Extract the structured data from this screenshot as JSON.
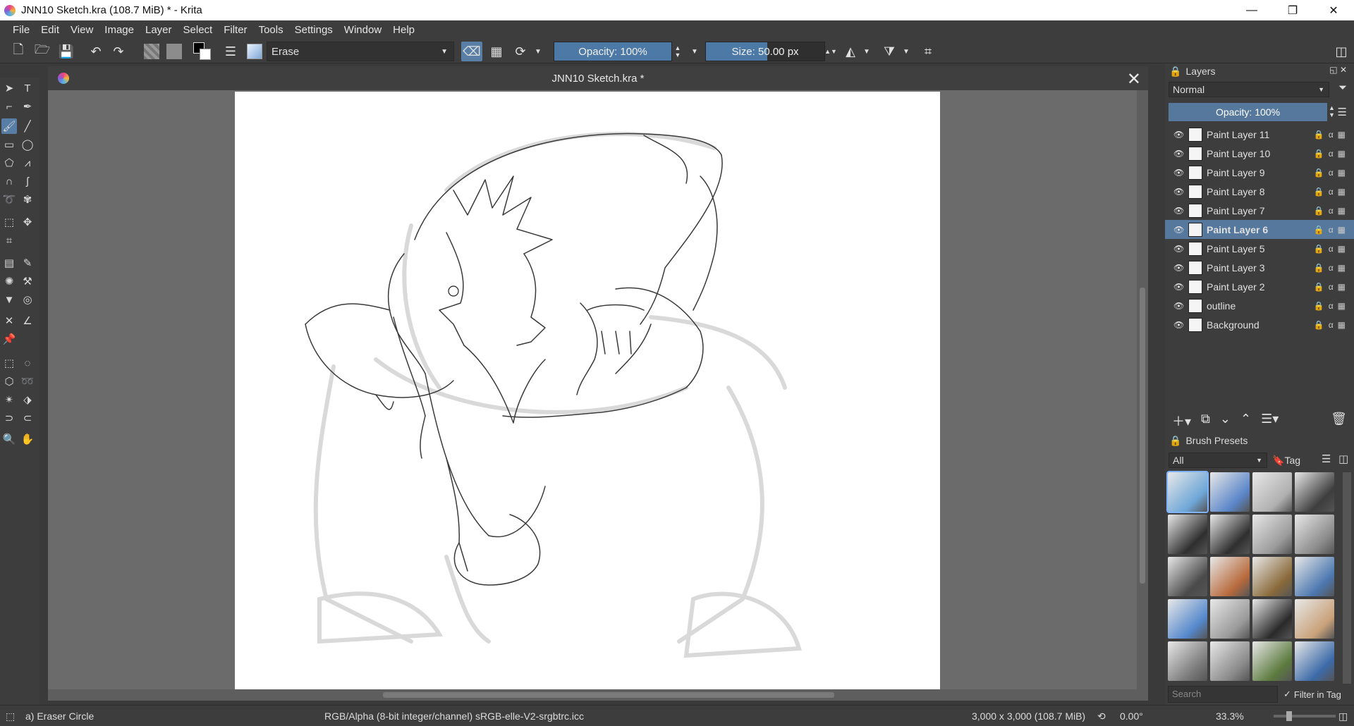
{
  "window": {
    "title": "JNN10 Sketch.kra (108.7 MiB)  * - Krita",
    "minimize": "—",
    "restore": "❐",
    "close": "✕"
  },
  "menubar": [
    "File",
    "Edit",
    "View",
    "Image",
    "Layer",
    "Select",
    "Filter",
    "Tools",
    "Settings",
    "Window",
    "Help"
  ],
  "toolbar": {
    "brush_name": "Erase",
    "opacity": "Opacity: 100%",
    "opacity_value": 1.0,
    "size": "Size: 50.00 px",
    "size_value": 50.0
  },
  "document": {
    "tab_title": "JNN10 Sketch.kra *",
    "close": "✕"
  },
  "layers_panel": {
    "title": "Layers",
    "blend_mode": "Normal",
    "opacity": "Opacity:  100%",
    "layers": [
      {
        "name": "Paint Layer 11",
        "selected": false
      },
      {
        "name": "Paint Layer 10",
        "selected": false
      },
      {
        "name": "Paint Layer 9",
        "selected": false
      },
      {
        "name": "Paint Layer 8",
        "selected": false
      },
      {
        "name": "Paint Layer 7",
        "selected": false
      },
      {
        "name": "Paint Layer 6",
        "selected": true
      },
      {
        "name": "Paint Layer 5",
        "selected": false
      },
      {
        "name": "Paint Layer 3",
        "selected": false
      },
      {
        "name": "Paint Layer 2",
        "selected": false
      },
      {
        "name": "outline",
        "selected": false
      },
      {
        "name": "Background",
        "selected": false
      }
    ]
  },
  "brush_presets": {
    "title": "Brush Presets",
    "filter": "All",
    "tag_label": "Tag",
    "search_placeholder": "Search",
    "filter_in_tag": "Filter in Tag"
  },
  "statusbar": {
    "tool": "a) Eraser Circle",
    "color_profile": "RGB/Alpha (8-bit integer/channel)  sRGB-elle-V2-srgbtrc.icc",
    "image_size": "3,000 x 3,000 (108.7 MiB)",
    "rotation": "0.00°",
    "zoom": "33.3%"
  },
  "colors": {
    "accent": "#55789c",
    "panel_bg": "#3d3d3d",
    "canvas_bg": "#6b6b6b"
  }
}
